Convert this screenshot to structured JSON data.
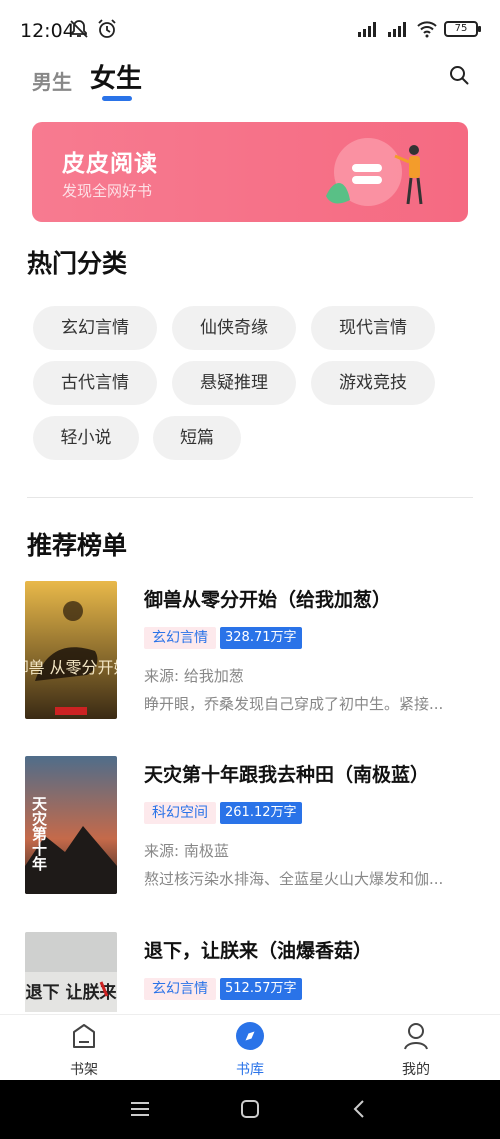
{
  "status_bar": {
    "time": "12:04",
    "battery": "75"
  },
  "tabs": {
    "male": "男生",
    "female": "女生"
  },
  "banner": {
    "title": "皮皮阅读",
    "subtitle": "发现全网好书"
  },
  "hot_categories": {
    "title": "热门分类",
    "items": [
      "玄幻言情",
      "仙侠奇缘",
      "现代言情",
      "古代言情",
      "悬疑推理",
      "游戏竞技",
      "轻小说",
      "短篇"
    ]
  },
  "ranking": {
    "title": "推荐榜单",
    "books": [
      {
        "title": "御兽从零分开始（给我加葱）",
        "genre": "玄幻言情",
        "words": "328.71万字",
        "source": "来源: 给我加葱",
        "desc": "睁开眼，乔桑发现自己穿成了初中生。紧接...",
        "cover_text": "御兽 从零分开始"
      },
      {
        "title": "天灾第十年跟我去种田（南极蓝）",
        "genre": "科幻空间",
        "words": "261.12万字",
        "source": "来源: 南极蓝",
        "desc": "熬过核污染水排海、全蓝星火山大爆发和伽...",
        "cover_text": "天灾第十年"
      },
      {
        "title": "退下，让朕来（油爆香菇）",
        "genre": "玄幻言情",
        "words": "512.57万字",
        "source": "",
        "desc": "",
        "cover_text": "退下 让朕来"
      }
    ]
  },
  "bottom_nav": {
    "shelf": "书架",
    "library": "书库",
    "mine": "我的"
  },
  "colors": {
    "accent": "#2a73e8",
    "banner": "#f56a82"
  }
}
